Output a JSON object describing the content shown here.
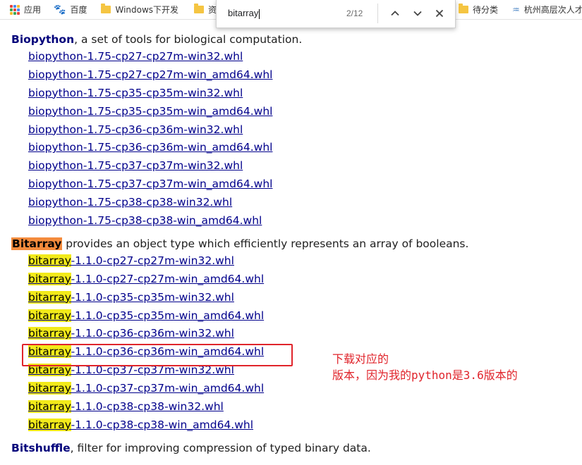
{
  "bookmarks": {
    "apps": "应用",
    "baidu": "百度",
    "windows_dev": "Windows下开发",
    "resources": "资",
    "pending": "待分类",
    "hangzhou": "杭州高层次人才"
  },
  "findbar": {
    "query": "bitarray",
    "count": "2/12"
  },
  "biopython": {
    "name": "Biopython",
    "desc": ", a set of tools for biological computation.",
    "links": [
      "biopython-1.75-cp27-cp27m-win32.whl",
      "biopython-1.75-cp27-cp27m-win_amd64.whl",
      "biopython-1.75-cp35-cp35m-win32.whl",
      "biopython-1.75-cp35-cp35m-win_amd64.whl",
      "biopython-1.75-cp36-cp36m-win32.whl",
      "biopython-1.75-cp36-cp36m-win_amd64.whl",
      "biopython-1.75-cp37-cp37m-win32.whl",
      "biopython-1.75-cp37-cp37m-win_amd64.whl",
      "biopython-1.75-cp38-cp38-win32.whl",
      "biopython-1.75-cp38-cp38-win_amd64.whl"
    ]
  },
  "bitarray": {
    "name": "Bitarray",
    "desc": " provides an object type which efficiently represents an array of booleans.",
    "match": "bitarray",
    "links": [
      "-1.1.0-cp27-cp27m-win32.whl",
      "-1.1.0-cp27-cp27m-win_amd64.whl",
      "-1.1.0-cp35-cp35m-win32.whl",
      "-1.1.0-cp35-cp35m-win_amd64.whl",
      "-1.1.0-cp36-cp36m-win32.whl",
      "-1.1.0-cp36-cp36m-win_amd64.whl",
      "-1.1.0-cp37-cp37m-win32.whl",
      "-1.1.0-cp37-cp37m-win_amd64.whl",
      "-1.1.0-cp38-cp38-win32.whl",
      "-1.1.0-cp38-cp38-win_amd64.whl"
    ]
  },
  "bitshuffle": {
    "name": "Bitshuffle",
    "desc": ", filter for improving compression of typed binary data."
  },
  "annotation": {
    "line1": "下载对应的",
    "line2": "版本，因为我的python是3.6版本的"
  },
  "colors": {
    "link": "#00008b",
    "heading": "#00007a",
    "match_highlight": "#f2ea1a",
    "active_match": "#f48b3c",
    "annotation": "#e0242b"
  }
}
